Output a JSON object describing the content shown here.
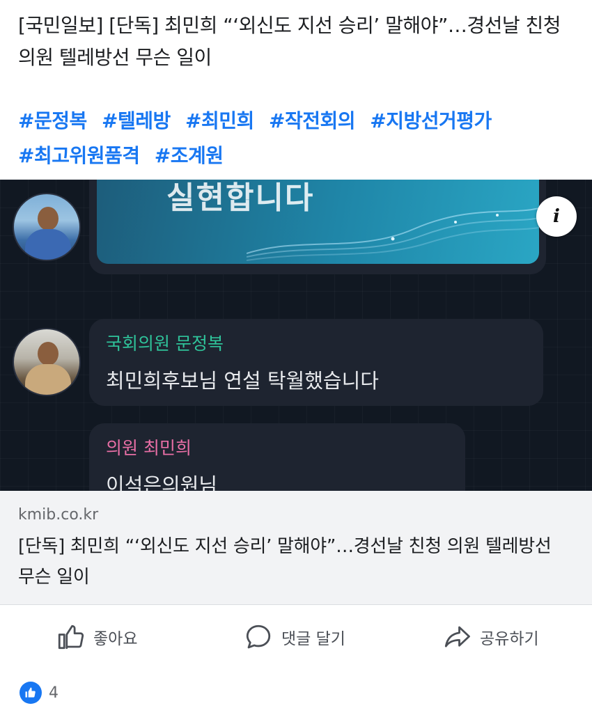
{
  "post": {
    "text": "[국민일보] [단독] 최민희 “‘외신도 지선 승리’ 말해야”…경선날 친청 의원 텔레방선 무슨 일이",
    "hashtags": [
      "#문정복",
      "#텔레방",
      "#최민희",
      "#작전회의",
      "#지방선거평가",
      "#최고위원품격",
      "#조계원"
    ]
  },
  "image": {
    "banner_text": "실현합니다",
    "messages": [
      {
        "sender": "국회의원 문정복",
        "text": "최민희후보님 연설 탁월했습니다"
      },
      {
        "sender": "의원 최민희",
        "text": "이석은의원님"
      }
    ],
    "info_icon": "info-icon"
  },
  "link": {
    "domain": "kmib.co.kr",
    "title": "[단독] 최민희 “‘외신도 지선 승리’ 말해야”…경선날 친청 의원 텔레방선 무슨 일이"
  },
  "actions": {
    "like_label": "좋아요",
    "comment_label": "댓글 달기",
    "share_label": "공유하기"
  },
  "reactions": {
    "count": "4"
  },
  "colors": {
    "hashtag": "#1877f2",
    "sender_1": "#2fc39a",
    "sender_2": "#e96fa6",
    "chat_background": "#111822"
  }
}
